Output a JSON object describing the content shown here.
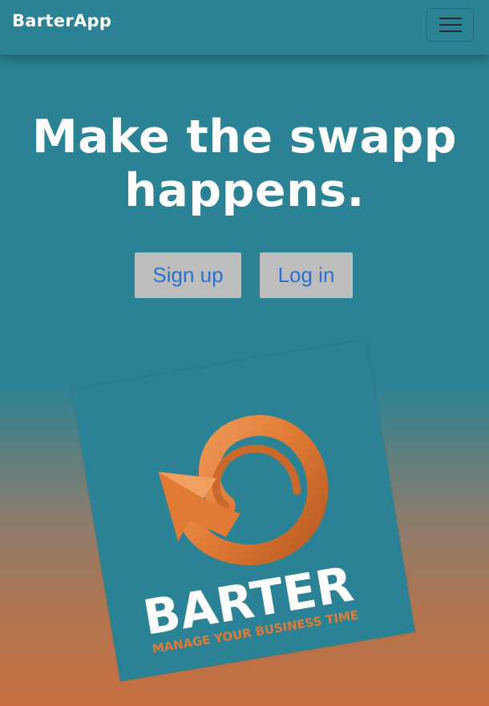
{
  "navbar": {
    "brand": "BarterApp",
    "menu_icon": "hamburger-menu-icon"
  },
  "hero": {
    "title": "Make the swapp happens."
  },
  "actions": {
    "signup_label": "Sign up",
    "login_label": "Log in"
  },
  "logo": {
    "wordmark": "BARTER",
    "tagline": "MANAGE YOUR BUSINESS TIME"
  },
  "colors": {
    "teal": "#2a8294",
    "orange": "#e07a35",
    "button_bg": "#bdbdbd",
    "button_text": "#2a71d0",
    "white": "#ffffff"
  }
}
